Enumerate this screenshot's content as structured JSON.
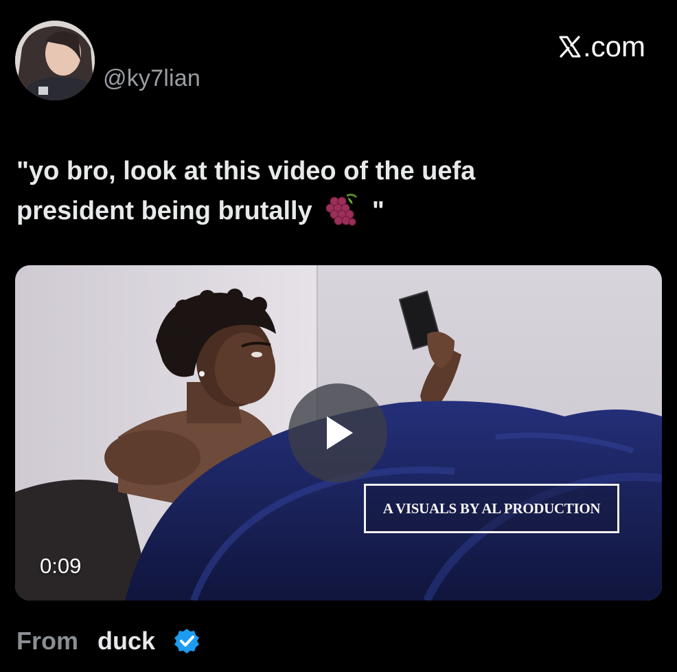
{
  "header": {
    "handle": "@ky7lian",
    "site": ".com",
    "site_logo_icon": "x-logo-icon"
  },
  "tweet": {
    "text_line1": "\"yo bro, look at this video of the uefa",
    "text_line2_before": "president being brutally",
    "emoji_icon": "grapes-icon",
    "text_line2_after": "\""
  },
  "video": {
    "duration": "0:09",
    "watermark": "A VISUALS BY AL PRODUCTION",
    "play_icon": "play-icon"
  },
  "footer": {
    "from_label": "From",
    "from_name": "duck",
    "badge_icon": "verified-badge-icon"
  },
  "colors": {
    "background": "#000000",
    "text": "#e7e9ea",
    "muted": "#8b8f94",
    "verified": "#1d9bf0"
  }
}
